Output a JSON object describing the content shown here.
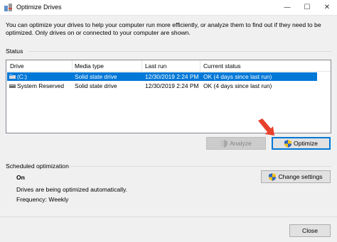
{
  "window": {
    "title": "Optimize Drives",
    "icon": "defrag-app-icon",
    "minimize_glyph": "—",
    "maximize_glyph": "☐",
    "close_glyph": "✕"
  },
  "intro_text": "You can optimize your drives to help your computer run more efficiently, or analyze them to find out if they need to be optimized. Only drives on or connected to your computer are shown.",
  "status": {
    "label": "Status",
    "columns": [
      "Drive",
      "Media type",
      "Last run",
      "Current status"
    ],
    "rows": [
      {
        "drive": "(C:)",
        "media_type": "Solid state drive",
        "last_run": "12/30/2019 2:24 PM",
        "current_status": "OK (4 days since last run)",
        "selected": true,
        "icon": "windows-drive-icon"
      },
      {
        "drive": "System Reserved",
        "media_type": "Solid state drive",
        "last_run": "12/30/2019 2:24 PM",
        "current_status": "OK (4 days since last run)",
        "selected": false,
        "icon": "drive-icon"
      }
    ],
    "analyze_label": "Analyze",
    "optimize_label": "Optimize"
  },
  "scheduled": {
    "label": "Scheduled optimization",
    "state": "On",
    "description": "Drives are being optimized automatically.",
    "frequency": "Frequency: Weekly",
    "change_settings_label": "Change settings"
  },
  "close_label": "Close",
  "colors": {
    "selection": "#0078d7",
    "annotation_arrow": "#e8412c",
    "window_bg": "#f0f0f0"
  }
}
